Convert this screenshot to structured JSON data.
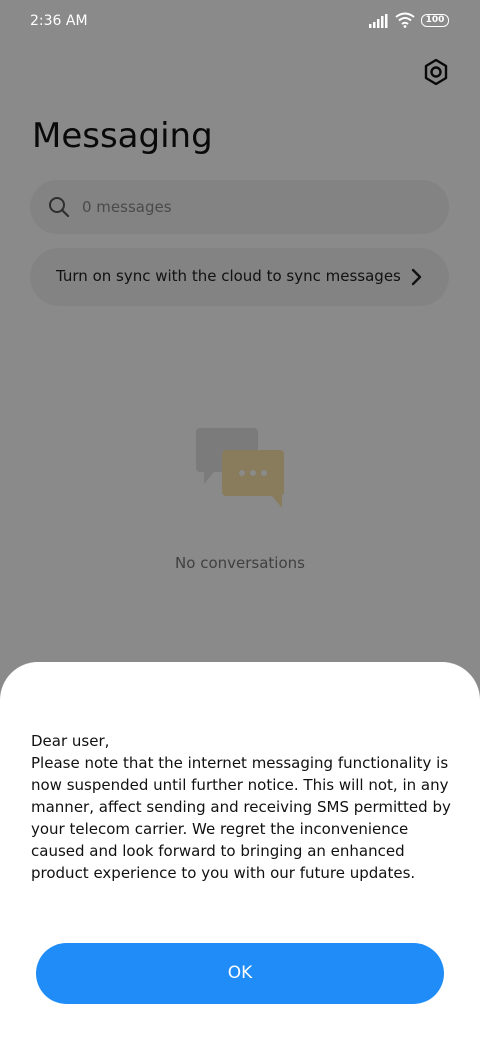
{
  "status_bar": {
    "time": "2:36 AM",
    "battery": "100"
  },
  "header": {
    "title": "Messaging",
    "settings_icon": "settings-hexagon-icon"
  },
  "search": {
    "text": "0 messages",
    "icon": "search-icon"
  },
  "sync_banner": {
    "text": "Turn on sync with the cloud to sync messages",
    "icon": "chevron-right-icon"
  },
  "empty_state": {
    "text": "No conversations",
    "icon": "chat-bubbles-icon"
  },
  "dialog": {
    "greeting": "Dear user,",
    "body": "Please note that the internet messaging functionality is now suspended until further notice. This will not, in any manner, affect sending and receiving SMS permitted by your telecom carrier. We regret the inconvenience caused and look forward to bringing an enhanced product experience to you with our future updates.",
    "ok_label": "OK"
  },
  "colors": {
    "accent": "#1f8cf7",
    "overlay": "rgba(0,0,0,0.46)",
    "empty_illustration": "#fde5ad"
  }
}
